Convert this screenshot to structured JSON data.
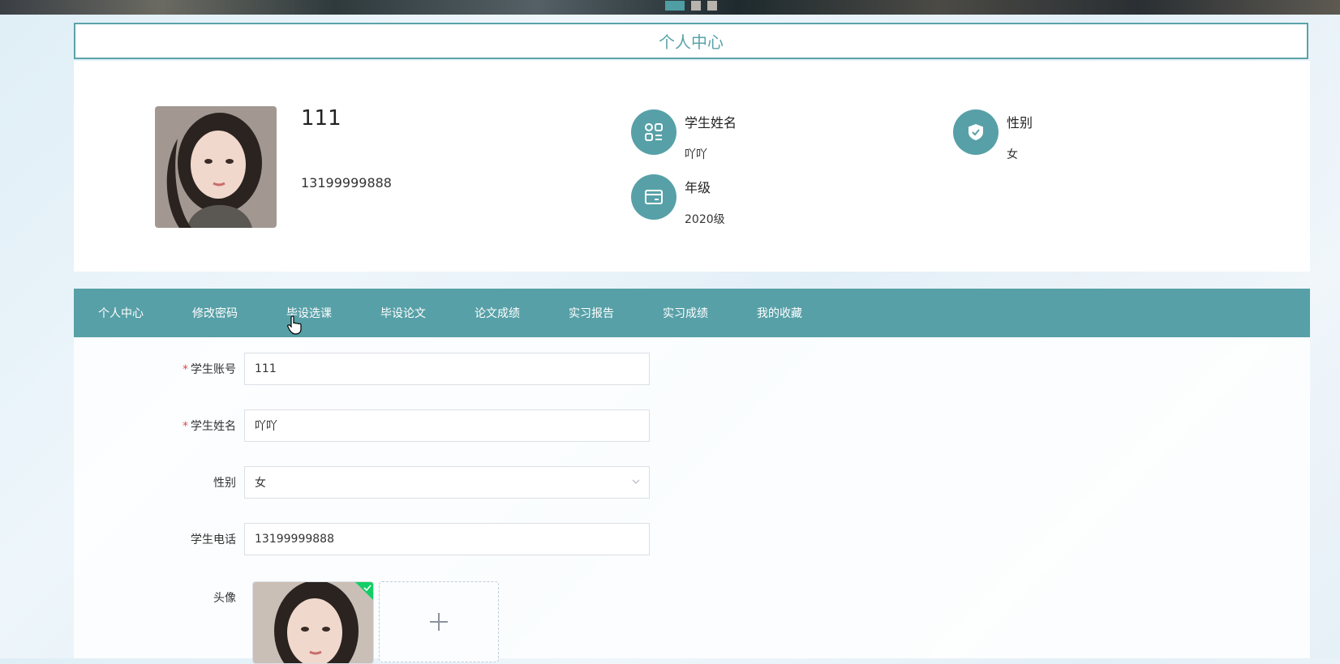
{
  "page": {
    "title": "个人中心"
  },
  "profile": {
    "username": "111",
    "phone": "13199999888",
    "fields": [
      {
        "label": "学生姓名",
        "value": "吖吖",
        "icon": "apps-icon"
      },
      {
        "label": "性别",
        "value": "女",
        "icon": "shield-check-icon"
      },
      {
        "label": "年级",
        "value": "2020级",
        "icon": "card-icon"
      }
    ]
  },
  "nav": {
    "items": [
      "个人中心",
      "修改密码",
      "毕设选课",
      "毕设论文",
      "论文成绩",
      "实习报告",
      "实习成绩",
      "我的收藏"
    ]
  },
  "form": {
    "account": {
      "label": "学生账号",
      "value": "111",
      "required": true
    },
    "name": {
      "label": "学生姓名",
      "value": "吖吖",
      "required": true
    },
    "gender": {
      "label": "性别",
      "value": "女"
    },
    "phone": {
      "label": "学生电话",
      "value": "13199999888"
    },
    "avatar": {
      "label": "头像"
    }
  },
  "colors": {
    "accent": "#57a0a7",
    "success": "#13ce66",
    "required": "#e04b4b"
  }
}
